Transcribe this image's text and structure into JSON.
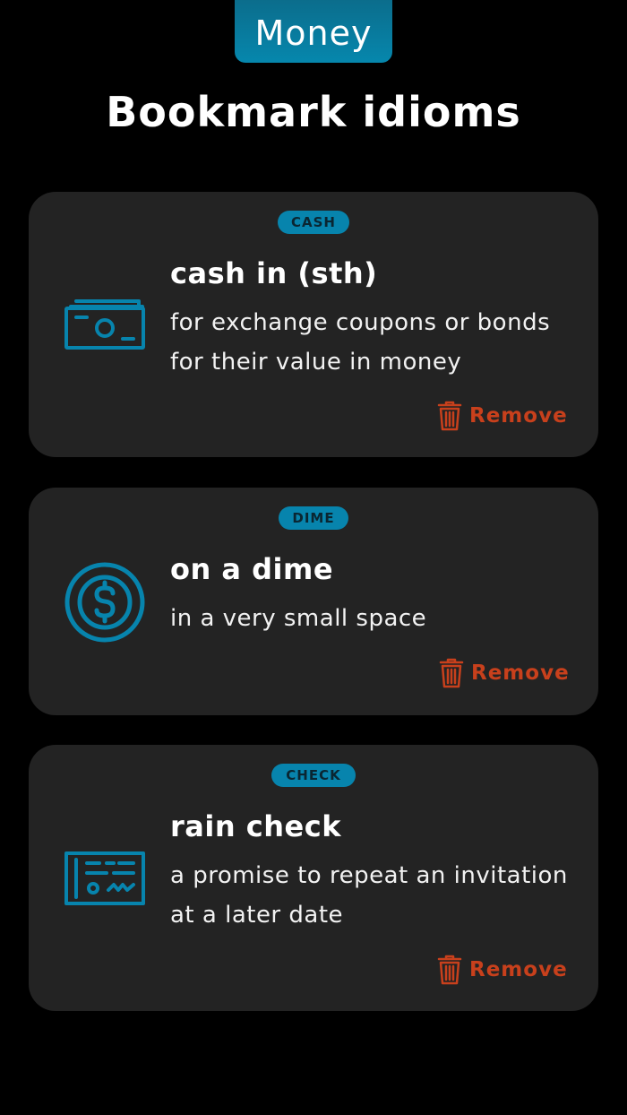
{
  "header": {
    "category_tab": "Money",
    "page_title": "Bookmark idioms"
  },
  "colors": {
    "accent": "#0784ad",
    "remove": "#c8401c",
    "card_bg": "#232323",
    "background": "#000000"
  },
  "cards": [
    {
      "badge": "CASH",
      "icon": "cash-bill-icon",
      "title": "cash in (sth)",
      "definition": "for exchange coupons or bonds for their value in money",
      "remove_label": "Remove"
    },
    {
      "badge": "DIME",
      "icon": "dollar-coin-icon",
      "title": "on a dime",
      "definition": "in a very small space",
      "remove_label": "Remove"
    },
    {
      "badge": "CHECK",
      "icon": "check-icon",
      "title": "rain check",
      "definition": "a promise to repeat an invitation at a later date",
      "remove_label": "Remove"
    }
  ]
}
